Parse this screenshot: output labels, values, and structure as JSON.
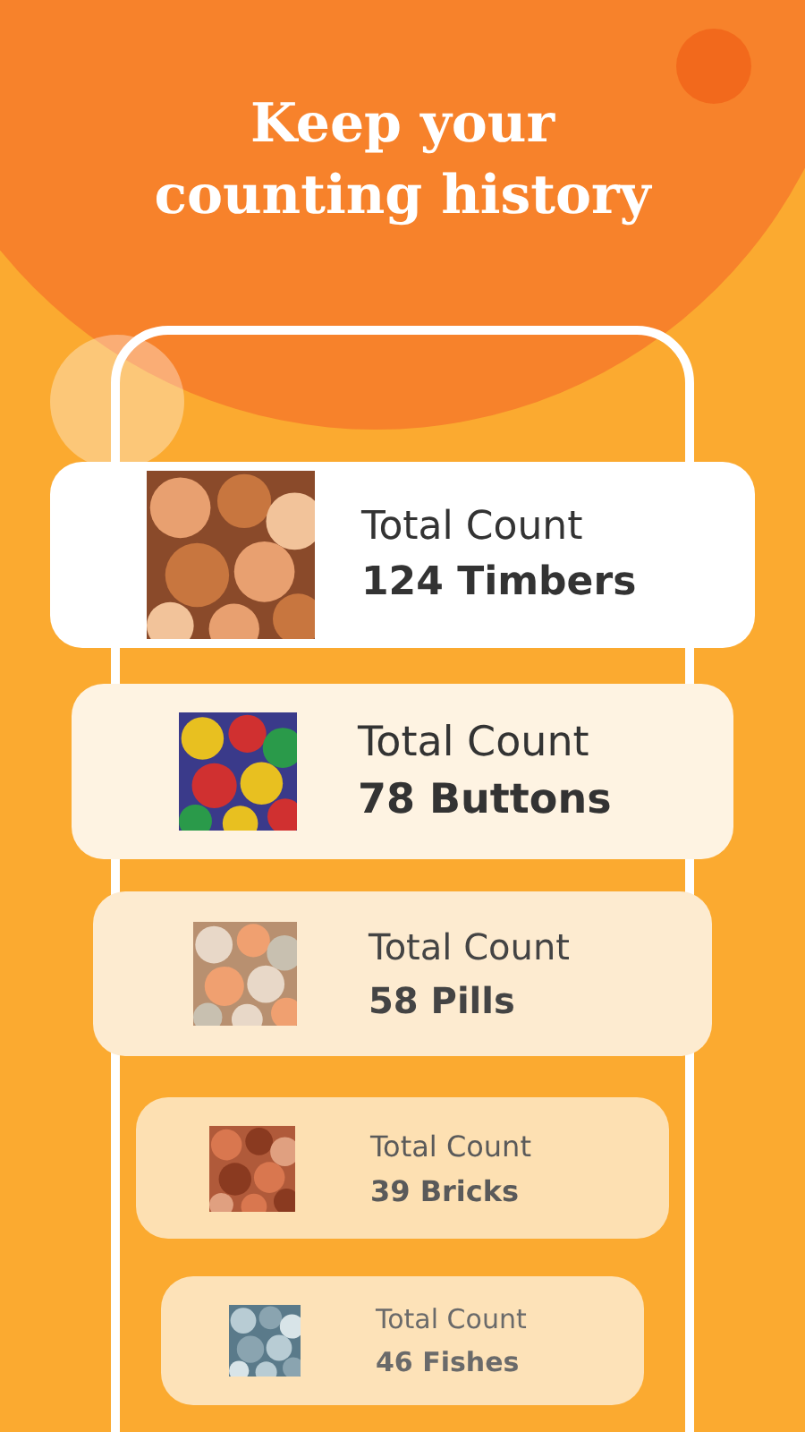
{
  "title": "Keep your counting history",
  "cards": [
    {
      "label": "Total Count",
      "count": "124 Timbers"
    },
    {
      "label": "Total Count",
      "count": "78 Buttons"
    },
    {
      "label": "Total Count",
      "count": "58 Pills"
    },
    {
      "label": "Total Count",
      "count": "39 Bricks"
    },
    {
      "label": "Total Count",
      "count": "46 Fishes"
    }
  ]
}
